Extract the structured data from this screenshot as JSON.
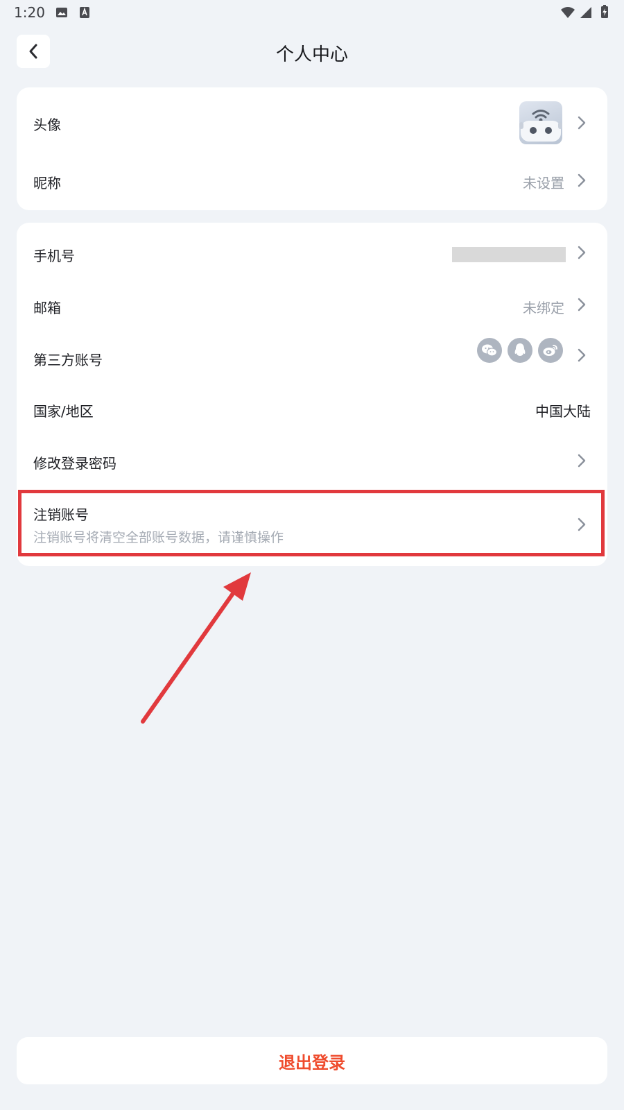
{
  "status_bar": {
    "time": "1:20",
    "icons": [
      "image-icon",
      "keyboard-a-icon",
      "wifi-icon",
      "signal-icon",
      "battery-charging-icon"
    ]
  },
  "header": {
    "title": "个人中心",
    "back_icon": "chevron-left-icon"
  },
  "profile_card": {
    "avatar_label": "头像",
    "nickname_label": "昵称",
    "nickname_value": "未设置"
  },
  "account_card": {
    "phone_label": "手机号",
    "email_label": "邮箱",
    "email_value": "未绑定",
    "third_party_label": "第三方账号",
    "third_party_icons": [
      "wechat-icon",
      "qq-icon",
      "weibo-icon"
    ],
    "region_label": "国家/地区",
    "region_value": "中国大陆",
    "password_label": "修改登录密码",
    "delete_label": "注销账号",
    "delete_description": "注销账号将清空全部账号数据，请谨慎操作"
  },
  "logout_label": "退出登录",
  "colors": {
    "background": "#f0f3f7",
    "card": "#ffffff",
    "annotation_red": "#e1393d",
    "logout_red": "#ef4b2d",
    "muted_text": "#9aa0aa"
  }
}
